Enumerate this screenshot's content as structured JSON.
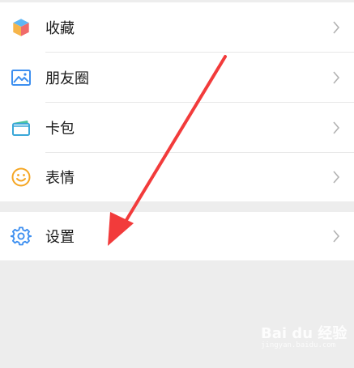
{
  "menu": {
    "items": [
      {
        "label": "收藏",
        "icon": "favorites-cube-icon"
      },
      {
        "label": "朋友圈",
        "icon": "moments-picture-icon"
      },
      {
        "label": "卡包",
        "icon": "card-wallet-icon"
      },
      {
        "label": "表情",
        "icon": "sticker-smiley-icon"
      }
    ],
    "settings": {
      "label": "设置",
      "icon": "gear-icon"
    }
  },
  "watermark": {
    "brand": "Bai du 经验",
    "sub": "jingyan.baidu.com"
  },
  "colors": {
    "background": "#ededed",
    "row": "#ffffff",
    "text": "#1a1a1a",
    "chevron": "#b2b2b2",
    "annotation_arrow": "#f23b3b"
  }
}
